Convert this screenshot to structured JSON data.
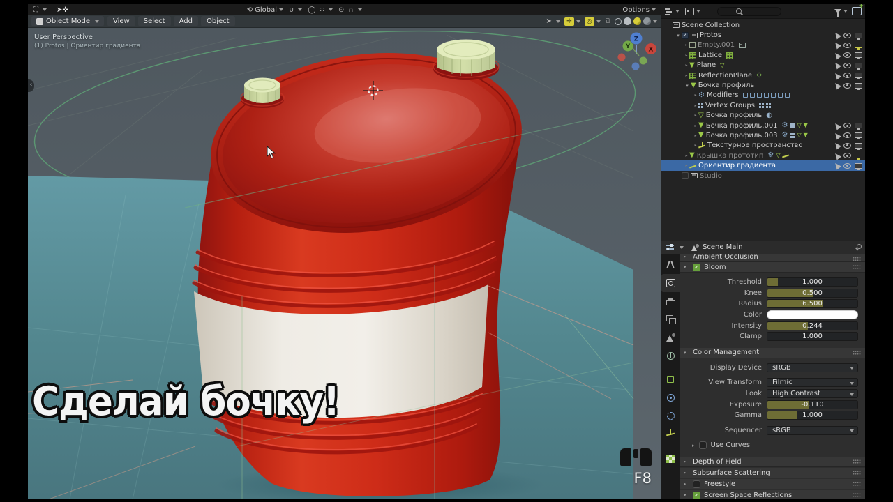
{
  "overlay": {
    "title": "Сделай бочку!",
    "screencast_key": "F8"
  },
  "viewport": {
    "row1": {
      "orientation_label": "Global",
      "options_label": "Options"
    },
    "row2": {
      "mode_label": "Object Mode",
      "menus": [
        "View",
        "Select",
        "Add",
        "Object"
      ]
    },
    "corner_text": [
      "User Perspective",
      "(1) Protos | Ориентир градиента"
    ],
    "gizmo": [
      "Z",
      "Y",
      "X"
    ],
    "sidebar_toggle": "‹"
  },
  "outliner": {
    "rows": [
      {
        "label": "Scene Collection",
        "icon": "collection",
        "indent": 0,
        "right": []
      },
      {
        "label": "Protos",
        "icon": "collection",
        "indent": 1,
        "twisty": "down",
        "check": "on",
        "right": [
          "arrow",
          "eye",
          "monitor"
        ]
      },
      {
        "label": "Empty.001",
        "icon": "empty",
        "indent": 2,
        "dim": true,
        "mark": true,
        "badges": [
          "img"
        ],
        "right": [
          "arrow",
          "eye",
          "monitor-off"
        ]
      },
      {
        "label": "Lattice",
        "icon": "lattice",
        "indent": 2,
        "mark": true,
        "badges": [
          "lattice"
        ],
        "right": [
          "arrow",
          "eye",
          "monitor"
        ]
      },
      {
        "label": "Plane",
        "icon": "tri",
        "indent": 2,
        "mark": true,
        "badges": [
          "tri-o"
        ],
        "right": [
          "arrow",
          "eye",
          "monitor"
        ]
      },
      {
        "label": "ReflectionPlane",
        "icon": "lattice",
        "indent": 2,
        "mark": true,
        "badges": [
          "dia"
        ],
        "right": [
          "arrow",
          "eye",
          "monitor"
        ]
      },
      {
        "label": "Бочка профиль",
        "icon": "tri",
        "indent": 2,
        "twisty": "down",
        "right": [
          "arrow",
          "eye",
          "monitor"
        ]
      },
      {
        "label": "Modifiers",
        "icon": "gear",
        "indent": 3,
        "mark": true,
        "badges": [
          "mod",
          "mod",
          "mod",
          "mod",
          "mod",
          "mod",
          "mod"
        ],
        "right": []
      },
      {
        "label": "Vertex Groups",
        "icon": "vg",
        "indent": 3,
        "mark": true,
        "badges": [
          "vg",
          "vg"
        ],
        "right": []
      },
      {
        "label": "Бочка профиль",
        "icon": "tri-o",
        "indent": 3,
        "mark": true,
        "badges": [
          "half"
        ],
        "right": []
      },
      {
        "label": "Бочка профиль.001",
        "icon": "tri",
        "indent": 3,
        "mark": true,
        "badges": [
          "gear",
          "vg",
          "tri-o",
          "tri"
        ],
        "right": [
          "arrow",
          "eye",
          "monitor"
        ]
      },
      {
        "label": "Бочка профиль.003",
        "icon": "tri",
        "indent": 3,
        "mark": true,
        "badges": [
          "gear",
          "vg",
          "tri-o",
          "tri"
        ],
        "right": [
          "arrow",
          "eye",
          "monitor"
        ]
      },
      {
        "label": "Текстурное пространство",
        "icon": "axes",
        "indent": 3,
        "mark": true,
        "right": [
          "arrow",
          "eye",
          "monitor"
        ]
      },
      {
        "label": "Крышка прототип",
        "icon": "tri",
        "indent": 2,
        "dim": true,
        "mark": true,
        "badges": [
          "gear",
          "tri-o",
          "axes"
        ],
        "right": [
          "arrow",
          "eye",
          "monitor-off"
        ]
      },
      {
        "label": "Ориентир градиента",
        "icon": "axes",
        "indent": 2,
        "selected": true,
        "mark": true,
        "right": [
          "arrow",
          "eye",
          "monitor"
        ]
      },
      {
        "label": "Studio",
        "icon": "collection",
        "indent": 1,
        "dim": true,
        "check": "off",
        "right": []
      }
    ]
  },
  "properties": {
    "header_title": "Scene Main",
    "partial_panel": "Ambient Occlusion",
    "bloom": {
      "label": "Bloom",
      "fields": [
        {
          "label": "Threshold",
          "value": "1.000",
          "fill": 12,
          "type": "slider"
        },
        {
          "label": "Knee",
          "value": "0.500",
          "fill": 50,
          "type": "slider"
        },
        {
          "label": "Radius",
          "value": "6.500",
          "fill": 62,
          "type": "slider"
        },
        {
          "label": "Color",
          "type": "color",
          "color": "#ffffff"
        },
        {
          "label": "Intensity",
          "value": "0.244",
          "fill": 45,
          "type": "slider"
        },
        {
          "label": "Clamp",
          "value": "1.000",
          "fill": 0,
          "type": "slider"
        }
      ]
    },
    "color_management": {
      "label": "Color Management",
      "rows": [
        {
          "label": "Display Device",
          "type": "dropdown",
          "value": "sRGB"
        },
        {
          "label": "View Transform",
          "type": "dropdown",
          "value": "Filmic",
          "gap": true
        },
        {
          "label": "Look",
          "type": "dropdown",
          "value": "High Contrast"
        },
        {
          "label": "Exposure",
          "type": "slider",
          "value": "-0.110",
          "fill": 46
        },
        {
          "label": "Gamma",
          "type": "slider",
          "value": "1.000",
          "fill": 33
        },
        {
          "label": "Sequencer",
          "type": "dropdown",
          "value": "sRGB",
          "gap": true
        },
        {
          "label": "Use Curves",
          "type": "checkbox",
          "checked": false,
          "gap": true
        }
      ]
    },
    "bottom_panels": [
      {
        "label": "Depth of Field",
        "arrow": "right"
      },
      {
        "label": "Subsurface Scattering",
        "arrow": "right"
      },
      {
        "label": "Freestyle",
        "arrow": "right",
        "checkbox": "off"
      },
      {
        "label": "Screen Space Reflections",
        "arrow": "down",
        "checkbox": "on"
      }
    ]
  },
  "colors": {
    "selection_blue": "#3b69a5",
    "slider_fill_olive": "#6e6d35",
    "enabled_check_green": "#67a03c",
    "active_toggle_yellow": "#d6cd3a",
    "viewport_floor_teal": "#4f8591",
    "viewport_background_gray": "#566066",
    "barrel_red": "#c62717",
    "barrel_band_white": "#e9e5de",
    "cap_pale_green": "#d7e2b0",
    "gizmo_x_red": "#c8463c",
    "gizmo_y_green": "#74aa48",
    "gizmo_z_blue": "#4f7fd0"
  }
}
